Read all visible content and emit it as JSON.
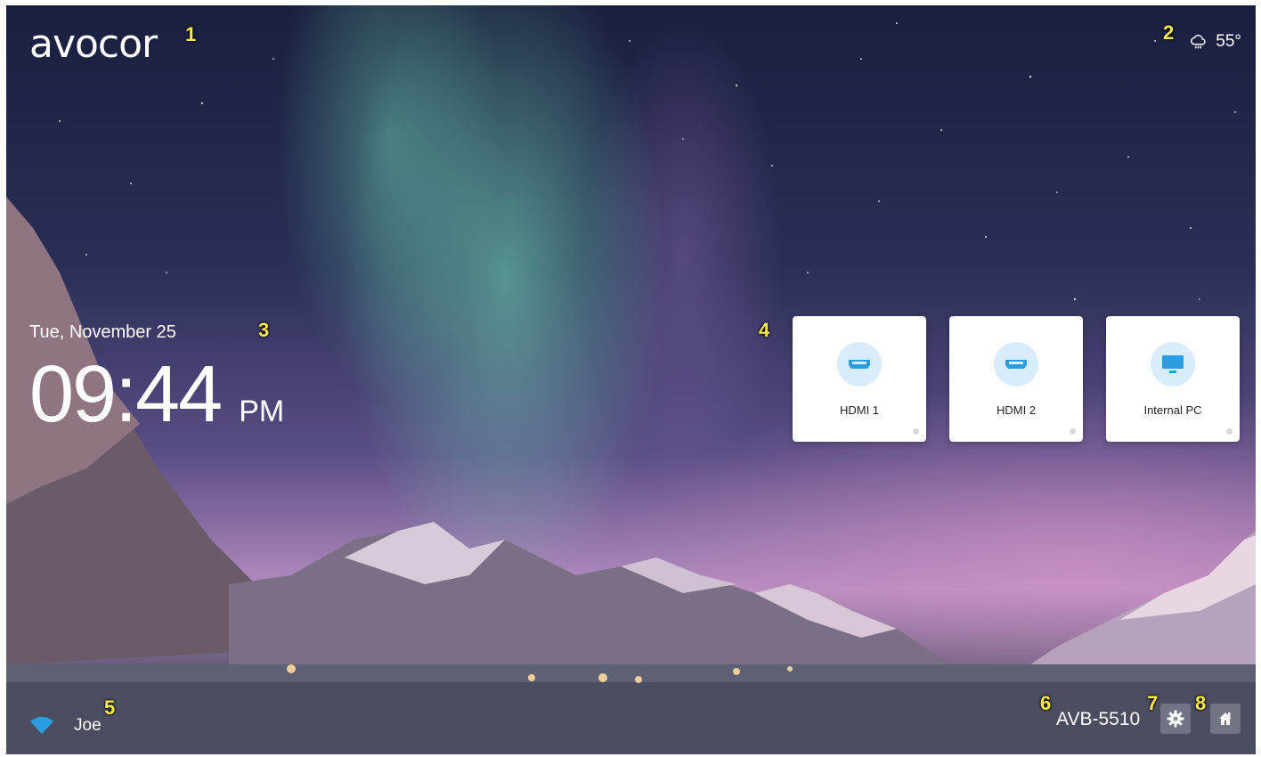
{
  "logo": {
    "text": "avocor"
  },
  "weather": {
    "icon": "rain-cloud-icon",
    "temperature": "55°"
  },
  "clock": {
    "date": "Tue, November 25",
    "time": "09:44",
    "ampm": "PM"
  },
  "sources": [
    {
      "label": "HDMI 1",
      "icon": "hdmi-icon"
    },
    {
      "label": "HDMI 2",
      "icon": "hdmi-icon"
    },
    {
      "label": "Internal PC",
      "icon": "monitor-icon"
    }
  ],
  "network": {
    "icon": "wifi-icon",
    "ssid": "Joe"
  },
  "device": {
    "name": "AVB-5510"
  },
  "toolbar": {
    "settings_icon": "gear-icon",
    "home_icon": "home-icon"
  },
  "callouts": [
    "1",
    "2",
    "3",
    "4",
    "5",
    "6",
    "7",
    "8"
  ],
  "colors": {
    "accent": "#2a9de0",
    "icon_bg": "#d9ecfb",
    "callout": "#ffe94a"
  }
}
